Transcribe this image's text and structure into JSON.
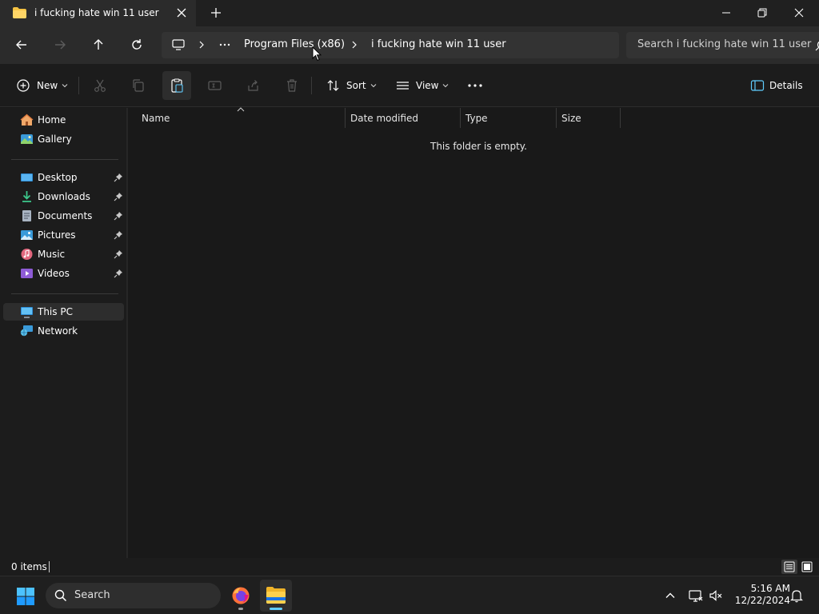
{
  "window": {
    "tab_title": "i fucking hate win 11 user",
    "icons": {
      "tab": "folder-icon",
      "close_tab": "close-icon",
      "new_tab": "plus-icon"
    }
  },
  "nav": {
    "breadcrumb": [
      {
        "label": "Program Files (x86)"
      },
      {
        "label": "i fucking hate win 11 user"
      }
    ],
    "search_placeholder": "Search i fucking hate win 11 user"
  },
  "commands": {
    "new_label": "New",
    "sort_label": "Sort",
    "view_label": "View",
    "details_label": "Details"
  },
  "sidebar": {
    "quick": [
      {
        "label": "Home",
        "icon": "home-icon"
      },
      {
        "label": "Gallery",
        "icon": "gallery-icon"
      }
    ],
    "pinned": [
      {
        "label": "Desktop",
        "icon": "desktop-icon"
      },
      {
        "label": "Downloads",
        "icon": "downloads-icon"
      },
      {
        "label": "Documents",
        "icon": "documents-icon"
      },
      {
        "label": "Pictures",
        "icon": "pictures-icon"
      },
      {
        "label": "Music",
        "icon": "music-icon"
      },
      {
        "label": "Videos",
        "icon": "videos-icon"
      }
    ],
    "devices": [
      {
        "label": "This PC",
        "icon": "this-pc-icon",
        "selected": true
      },
      {
        "label": "Network",
        "icon": "network-icon"
      }
    ]
  },
  "columns": [
    {
      "label": "Name"
    },
    {
      "label": "Date modified"
    },
    {
      "label": "Type"
    },
    {
      "label": "Size"
    }
  ],
  "empty_message": "This folder is empty.",
  "status": {
    "items": "0 items"
  },
  "taskbar": {
    "search_label": "Search",
    "time": "5:16 AM",
    "date": "12/22/2024"
  },
  "colors": {
    "accent": "#60cdff",
    "folder_yellow": "#f6c343",
    "background": "#191919"
  }
}
